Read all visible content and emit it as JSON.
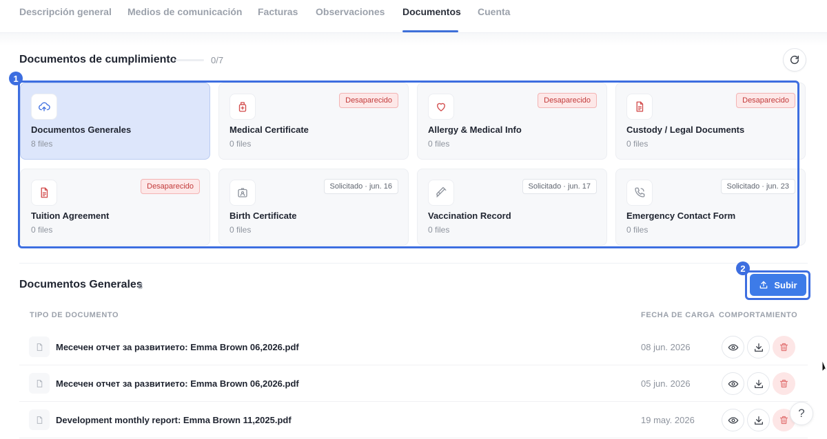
{
  "tabs": [
    {
      "label": "Descripción general"
    },
    {
      "label": "Medios de comunicación"
    },
    {
      "label": "Facturas"
    },
    {
      "label": "Observaciones"
    },
    {
      "label": "Documentos"
    },
    {
      "label": "Cuenta"
    }
  ],
  "active_tab": "Documentos",
  "compliance": {
    "title": "Documentos de cumplimiento",
    "progress_text": "0/7",
    "progress_fraction": 0,
    "refresh_icon": "refresh-icon"
  },
  "annotations": {
    "badge1": "1",
    "badge2": "2",
    "color": "#3d6ee0"
  },
  "cards": [
    {
      "title": "Documentos Generales",
      "count": "8 files",
      "icon": "cloud-upload-icon",
      "status": "",
      "selected": true
    },
    {
      "title": "Medical Certificate",
      "count": "0 files",
      "icon": "medical-bottle-icon",
      "status": "Desaparecido",
      "status_type": "missing"
    },
    {
      "title": "Allergy & Medical Info",
      "count": "0 files",
      "icon": "heart-icon",
      "status": "Desaparecido",
      "status_type": "missing"
    },
    {
      "title": "Custody / Legal Documents",
      "count": "0 files",
      "icon": "document-icon",
      "status": "Desaparecido",
      "status_type": "missing"
    },
    {
      "title": "Tuition Agreement",
      "count": "0 files",
      "icon": "document-icon",
      "status": "Desaparecido",
      "status_type": "missing"
    },
    {
      "title": "Birth Certificate",
      "count": "0 files",
      "icon": "id-card-icon",
      "status": "Solicitado · jun. 16",
      "status_type": "requested"
    },
    {
      "title": "Vaccination Record",
      "count": "0 files",
      "icon": "syringe-icon",
      "status": "Solicitado · jun. 17",
      "status_type": "requested"
    },
    {
      "title": "Emergency Contact Form",
      "count": "0 files",
      "icon": "phone-icon",
      "status": "Solicitado · jun. 23",
      "status_type": "requested"
    }
  ],
  "documents": {
    "title": "Documentos Generales",
    "count": "8",
    "upload_label": "Subir",
    "headers": {
      "type": "TIPO DE DOCUMENTO",
      "date": "FECHA DE CARGA",
      "actions": "COMPORTAMIENTO"
    },
    "rows": [
      {
        "name": "Месечен отчет за развитието: Emma Brown 06,2026.pdf",
        "date": "08 jun. 2026"
      },
      {
        "name": "Месечен отчет за развитието: Emma Brown 06,2026.pdf",
        "date": "05 jun. 2026"
      },
      {
        "name": "Development monthly report: Emma Brown 11,2025.pdf",
        "date": "19 may. 2026"
      }
    ]
  },
  "help": {
    "label": "?"
  },
  "colors": {
    "accent": "#3d7be8",
    "missing": "#c23a3a",
    "selected_card": "#dde6fb"
  }
}
